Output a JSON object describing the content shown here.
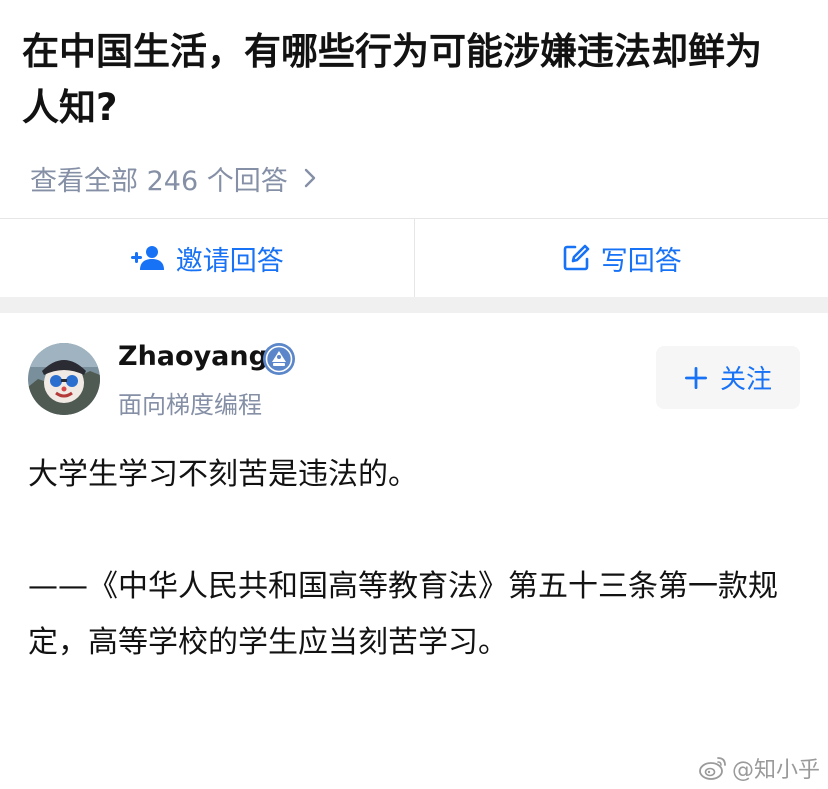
{
  "question": {
    "title": "在中国生活，有哪些行为可能涉嫌违法却鲜为人知?",
    "view_all_label": "查看全部 246 个回答"
  },
  "actions": {
    "invite_label": "邀请回答",
    "write_label": "写回答"
  },
  "answer": {
    "author_name": "Zhaoyang",
    "author_headline": "面向梯度编程",
    "follow_label": "关注",
    "paragraphs": [
      "大学生学习不刻苦是违法的。",
      "——《中华人民共和国高等教育法》第五十三条第一款规定，高等学校的学生应当刻苦学习。"
    ]
  },
  "watermark": {
    "text": "@知小乎"
  },
  "icons": {
    "chevron": "chevron-right-icon",
    "invite": "add-person-icon",
    "write": "edit-icon",
    "follow": "plus-icon",
    "badge": "verified-badge-icon",
    "weibo": "weibo-icon"
  },
  "colors": {
    "accent": "#1772f6",
    "secondary_text": "#8590a6",
    "primary_text": "#121212",
    "divider": "#e6e6e6",
    "band": "#f0f0f1"
  }
}
